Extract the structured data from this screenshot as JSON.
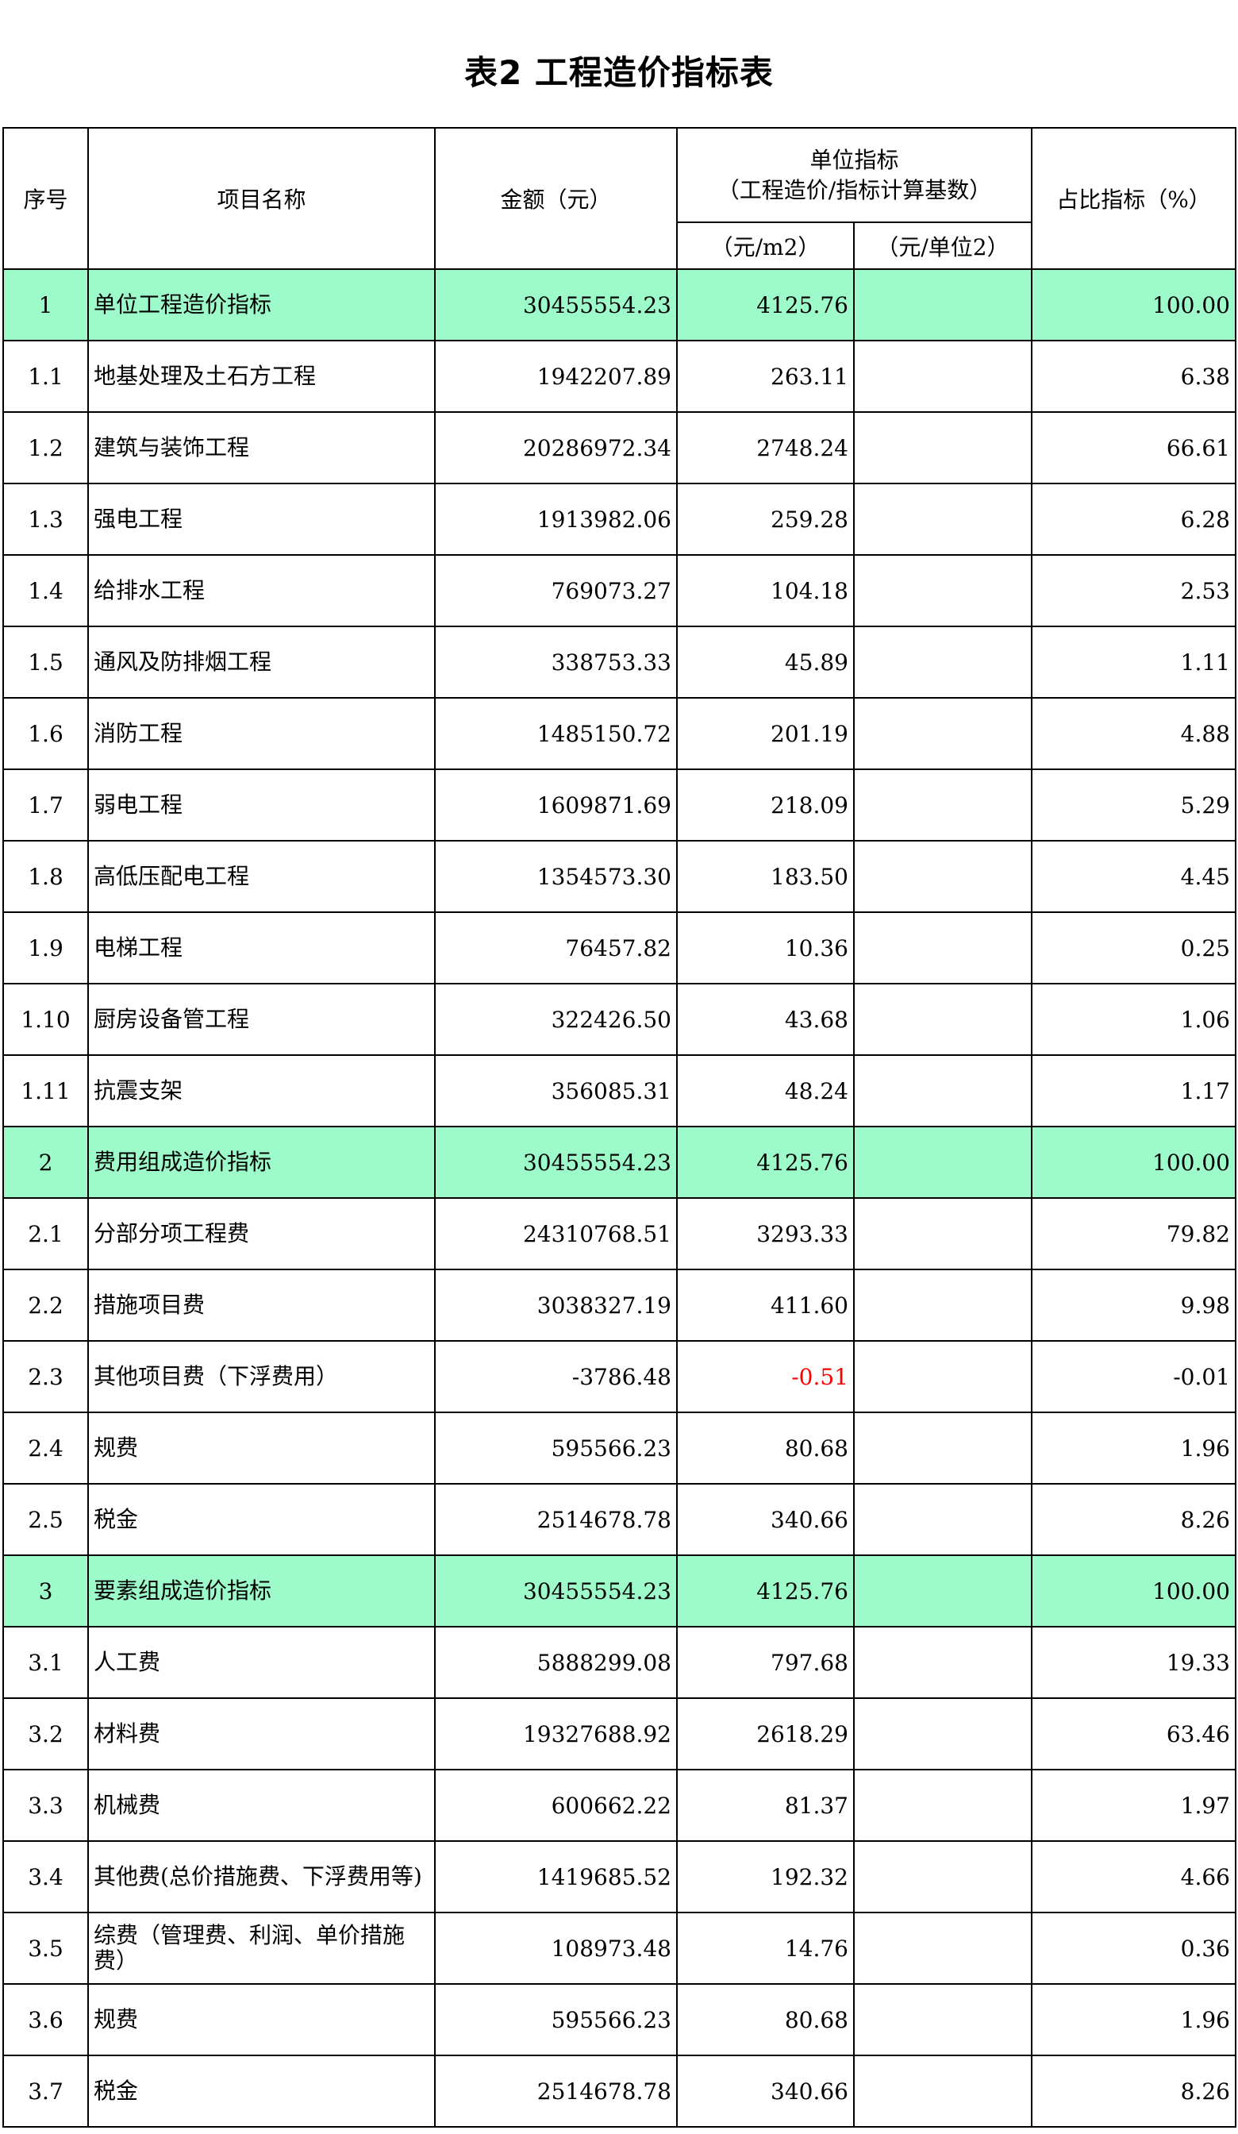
{
  "title": "表2   工程造价指标表",
  "header": {
    "seq": "序号",
    "name": "项目名称",
    "amount": "金额（元）",
    "unit_index": "单位指标",
    "unit_index_sub": "（工程造价/指标计算基数）",
    "per_m2": "（元/m2）",
    "per_unit2": "（元/单位2）",
    "ratio": "占比指标（%）"
  },
  "rows": [
    {
      "seq": "1",
      "name": "单位工程造价指标",
      "amount": "30455554.23",
      "per_m2": "4125.76",
      "per_unit2": "",
      "ratio": "100.00",
      "group": true
    },
    {
      "seq": "1.1",
      "name": "地基处理及土石方工程",
      "amount": "1942207.89",
      "per_m2": "263.11",
      "per_unit2": "",
      "ratio": "6.38"
    },
    {
      "seq": "1.2",
      "name": "建筑与装饰工程",
      "amount": "20286972.34",
      "per_m2": "2748.24",
      "per_unit2": "",
      "ratio": "66.61"
    },
    {
      "seq": "1.3",
      "name": "强电工程",
      "amount": "1913982.06",
      "per_m2": "259.28",
      "per_unit2": "",
      "ratio": "6.28"
    },
    {
      "seq": "1.4",
      "name": "给排水工程",
      "amount": "769073.27",
      "per_m2": "104.18",
      "per_unit2": "",
      "ratio": "2.53"
    },
    {
      "seq": "1.5",
      "name": "通风及防排烟工程",
      "amount": "338753.33",
      "per_m2": "45.89",
      "per_unit2": "",
      "ratio": "1.11"
    },
    {
      "seq": "1.6",
      "name": "消防工程",
      "amount": "1485150.72",
      "per_m2": "201.19",
      "per_unit2": "",
      "ratio": "4.88"
    },
    {
      "seq": "1.7",
      "name": "弱电工程",
      "amount": "1609871.69",
      "per_m2": "218.09",
      "per_unit2": "",
      "ratio": "5.29"
    },
    {
      "seq": "1.8",
      "name": "高低压配电工程",
      "amount": "1354573.30",
      "per_m2": "183.50",
      "per_unit2": "",
      "ratio": "4.45"
    },
    {
      "seq": "1.9",
      "name": "电梯工程",
      "amount": "76457.82",
      "per_m2": "10.36",
      "per_unit2": "",
      "ratio": "0.25"
    },
    {
      "seq": "1.10",
      "name": "厨房设备管工程",
      "amount": "322426.50",
      "per_m2": "43.68",
      "per_unit2": "",
      "ratio": "1.06"
    },
    {
      "seq": "1.11",
      "name": "抗震支架",
      "amount": "356085.31",
      "per_m2": "48.24",
      "per_unit2": "",
      "ratio": "1.17"
    },
    {
      "seq": "2",
      "name": "费用组成造价指标",
      "amount": "30455554.23",
      "per_m2": "4125.76",
      "per_unit2": "",
      "ratio": "100.00",
      "group": true
    },
    {
      "seq": "2.1",
      "name": "分部分项工程费",
      "amount": "24310768.51",
      "per_m2": "3293.33",
      "per_unit2": "",
      "ratio": "79.82"
    },
    {
      "seq": "2.2",
      "name": "措施项目费",
      "amount": "3038327.19",
      "per_m2": "411.60",
      "per_unit2": "",
      "ratio": "9.98"
    },
    {
      "seq": "2.3",
      "name": "其他项目费（下浮费用）",
      "amount": "-3786.48",
      "per_m2": "-0.51",
      "per_unit2": "",
      "ratio": "-0.01",
      "negative_m2": true
    },
    {
      "seq": "2.4",
      "name": "规费",
      "amount": "595566.23",
      "per_m2": "80.68",
      "per_unit2": "",
      "ratio": "1.96"
    },
    {
      "seq": "2.5",
      "name": "税金",
      "amount": "2514678.78",
      "per_m2": "340.66",
      "per_unit2": "",
      "ratio": "8.26"
    },
    {
      "seq": "3",
      "name": "要素组成造价指标",
      "amount": "30455554.23",
      "per_m2": "4125.76",
      "per_unit2": "",
      "ratio": "100.00",
      "group": true
    },
    {
      "seq": "3.1",
      "name": "人工费",
      "amount": "5888299.08",
      "per_m2": "797.68",
      "per_unit2": "",
      "ratio": "19.33"
    },
    {
      "seq": "3.2",
      "name": "材料费",
      "amount": "19327688.92",
      "per_m2": "2618.29",
      "per_unit2": "",
      "ratio": "63.46"
    },
    {
      "seq": "3.3",
      "name": "机械费",
      "amount": "600662.22",
      "per_m2": "81.37",
      "per_unit2": "",
      "ratio": "1.97"
    },
    {
      "seq": "3.4",
      "name": "其他费(总价措施费、下浮费用等)",
      "amount": "1419685.52",
      "per_m2": "192.32",
      "per_unit2": "",
      "ratio": "4.66"
    },
    {
      "seq": "3.5",
      "name": "综费（管理费、利润、单价措施费）",
      "amount": "108973.48",
      "per_m2": "14.76",
      "per_unit2": "",
      "ratio": "0.36"
    },
    {
      "seq": "3.6",
      "name": "规费",
      "amount": "595566.23",
      "per_m2": "80.68",
      "per_unit2": "",
      "ratio": "1.96"
    },
    {
      "seq": "3.7",
      "name": "税金",
      "amount": "2514678.78",
      "per_m2": "340.66",
      "per_unit2": "",
      "ratio": "8.26"
    }
  ],
  "colors": {
    "group_row_bg": "#9dfbca",
    "negative_text": "#ff0000",
    "border": "#000000"
  }
}
